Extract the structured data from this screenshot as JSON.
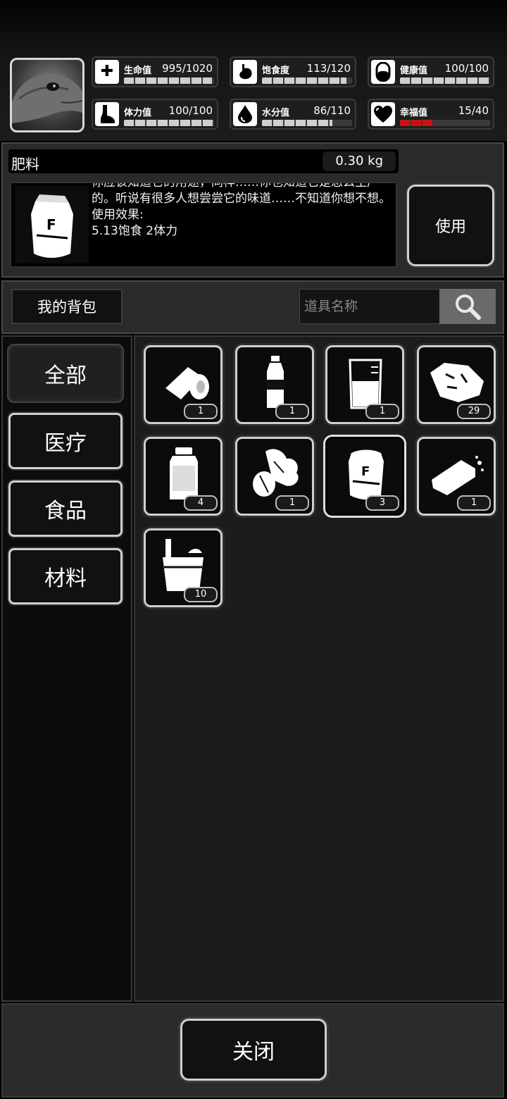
{
  "stats": [
    {
      "name": "生命值",
      "value": "995/1020",
      "icon": "first-aid-icon",
      "fill": 0.975
    },
    {
      "name": "饱食度",
      "value": "113/120",
      "icon": "stomach-icon",
      "fill": 0.94
    },
    {
      "name": "健康值",
      "value": "100/100",
      "icon": "pill-icon",
      "fill": 1.0
    },
    {
      "name": "体力值",
      "value": "100/100",
      "icon": "foot-icon",
      "fill": 1.0
    },
    {
      "name": "水分值",
      "value": "86/110",
      "icon": "water-drop-icon",
      "fill": 0.78
    },
    {
      "name": "幸福值",
      "value": "15/40",
      "icon": "heart-icon",
      "fill": 0.375,
      "bar_color": "#cc1010"
    }
  ],
  "item_info": {
    "name": "肥料",
    "weight": "0.30 kg",
    "description": "你应该知道它的用途，同样……你也知道它是怎么生产的。听说有很多人想尝尝它的味道……不知道你想不想。\n使用效果:\n5.13饱食 2体力",
    "use_label": "使用"
  },
  "backpack": {
    "title": "我的背包",
    "search_placeholder": "道具名称"
  },
  "categories": [
    {
      "label": "全部",
      "active": true
    },
    {
      "label": "医疗",
      "active": false
    },
    {
      "label": "食品",
      "active": false
    },
    {
      "label": "材料",
      "active": false
    }
  ],
  "items": [
    {
      "icon": "bandage-icon",
      "count": "1"
    },
    {
      "icon": "water-bottle-icon",
      "count": "1"
    },
    {
      "icon": "beaker-icon",
      "count": "1"
    },
    {
      "icon": "meat-chunk-icon",
      "count": "29"
    },
    {
      "icon": "jar-icon",
      "count": "4"
    },
    {
      "icon": "vegetables-icon",
      "count": "1"
    },
    {
      "icon": "fertilizer-bag-icon",
      "count": "3",
      "selected": true
    },
    {
      "icon": "bread-icon",
      "count": "1"
    },
    {
      "icon": "bucket-icon",
      "count": "10"
    }
  ],
  "close_label": "关闭"
}
